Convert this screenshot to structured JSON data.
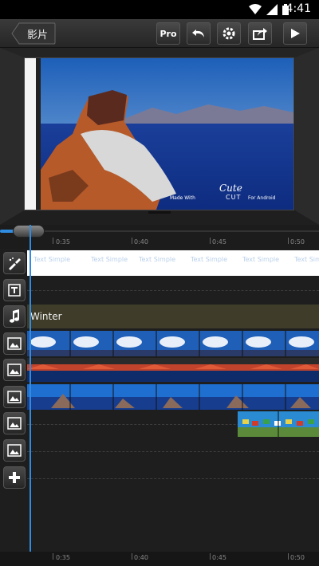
{
  "status": {
    "time": "4:41",
    "icons": [
      "wifi-icon",
      "signal-icon",
      "battery-icon"
    ]
  },
  "toolbar": {
    "back_label": "影片",
    "pro_label": "Pro",
    "buttons": [
      "undo-icon",
      "gear-icon",
      "share-icon",
      "play-icon"
    ]
  },
  "preview": {
    "cute_text": "Cute",
    "cut_text": "CUT",
    "made_text": "Made With",
    "android_text": "For Android"
  },
  "ruler": {
    "labels": [
      "0:35",
      "0:40",
      "0:45",
      "0:50"
    ]
  },
  "tracks": {
    "tool_icon": "brush-icon",
    "text_icon": "text-icon",
    "audio_icon": "music-note-icon",
    "image_icon": "image-icon",
    "add_icon": "plus-icon",
    "audio_label": "Winter",
    "text_watermark": "Text Simple"
  },
  "colors": {
    "accent": "#2f8ce0",
    "audio_track": "#3f3d2a",
    "toolbar": "#2e2e2e"
  }
}
